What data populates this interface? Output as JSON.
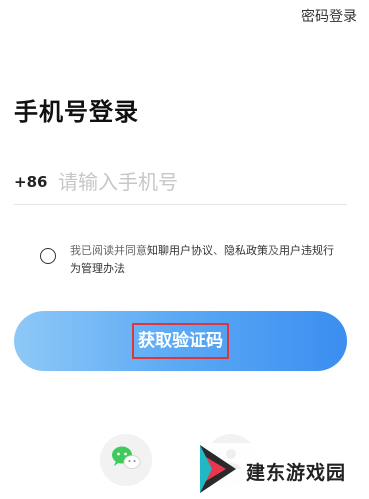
{
  "header": {
    "password_login": "密码登录"
  },
  "title": "手机号登录",
  "phone": {
    "country_code": "+86",
    "placeholder": "请输入手机号",
    "value": ""
  },
  "agreement": {
    "prefix": "我已阅读并同意",
    "user_agreement": "知聊用户协议",
    "sep1": "、",
    "privacy_policy": "隐私政策",
    "sep2": "及",
    "violation_rules": "用户违规行为管理办法",
    "checked": false
  },
  "cta": {
    "label": "获取验证码"
  },
  "social": [
    {
      "icon": "wechat-icon"
    },
    {
      "icon": "account-icon"
    }
  ],
  "watermark": {
    "text": "建东游戏园"
  },
  "colors": {
    "cta_start": "#8ec8f6",
    "cta_end": "#3b8ef0",
    "highlight_border": "#e0363a",
    "wechat_green": "#3fcb5b"
  }
}
